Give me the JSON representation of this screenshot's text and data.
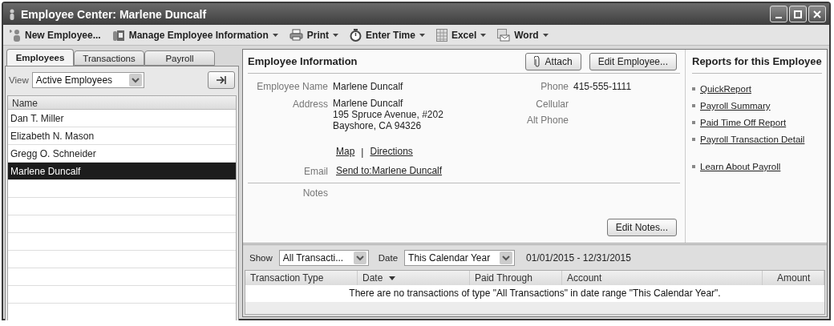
{
  "window": {
    "title": "Employee Center: Marlene Duncalf"
  },
  "toolbar": [
    {
      "kind": "new",
      "label": "New Employee...",
      "dropdown": false
    },
    {
      "kind": "manage",
      "label": "Manage Employee Information",
      "dropdown": true
    },
    {
      "kind": "print",
      "label": "Print",
      "dropdown": true
    },
    {
      "kind": "time",
      "label": "Enter Time",
      "dropdown": true
    },
    {
      "kind": "excel",
      "label": "Excel",
      "dropdown": true
    },
    {
      "kind": "word",
      "label": "Word",
      "dropdown": true
    }
  ],
  "tabs": [
    {
      "label": "Employees",
      "selected": true
    },
    {
      "label": "Transactions",
      "selected": false
    },
    {
      "label": "Payroll",
      "selected": false
    }
  ],
  "view": {
    "label": "View",
    "value": "Active Employees"
  },
  "employee_list": {
    "column": "Name",
    "rows": [
      {
        "name": "Dan T. Miller",
        "selected": false
      },
      {
        "name": "Elizabeth N. Mason",
        "selected": false
      },
      {
        "name": "Gregg O. Schneider",
        "selected": false
      },
      {
        "name": "Marlene Duncalf",
        "selected": true
      }
    ]
  },
  "employee_information": {
    "title": "Employee Information",
    "attach_button": "Attach",
    "edit_button": "Edit Employee...",
    "name_label": "Employee Name",
    "name": "Marlene Duncalf",
    "address_label": "Address",
    "address_lines": [
      "Marlene Duncalf",
      "195 Spruce Avenue, #202",
      "Bayshore, CA 94326"
    ],
    "map_link": "Map",
    "separator": "|",
    "directions_link": "Directions",
    "email_label": "Email",
    "email_link": "Send to:Marlene Duncalf",
    "phones": [
      {
        "label": "Phone",
        "value": "415-555-1111"
      },
      {
        "label": "Cellular"
      },
      {
        "label": "Alt Phone"
      }
    ],
    "notes_label": "Notes",
    "notes_button": "Edit Notes..."
  },
  "reports": {
    "title": "Reports for this Employee",
    "report_links": [
      "QuickReport",
      "Payroll Summary",
      "Paid Time Off Report",
      "Payroll Transaction Detail"
    ],
    "help_links": [
      "Learn About Payroll"
    ]
  },
  "transactions": {
    "show_label": "Show",
    "show_value": "All Transacti...",
    "date_label": "Date",
    "date_value": "This Calendar Year",
    "date_range": "01/01/2015 - 12/31/2015",
    "columns": [
      {
        "label": "Transaction Type",
        "sorted": false
      },
      {
        "label": "Date",
        "sorted": true
      },
      {
        "label": "Paid Through",
        "sorted": false
      },
      {
        "label": "Account",
        "sorted": false
      },
      {
        "label": "Amount",
        "sorted": false
      }
    ],
    "empty_message": "There are no transactions of type \"All Transactions\" in date range \"This Calendar Year\"."
  }
}
